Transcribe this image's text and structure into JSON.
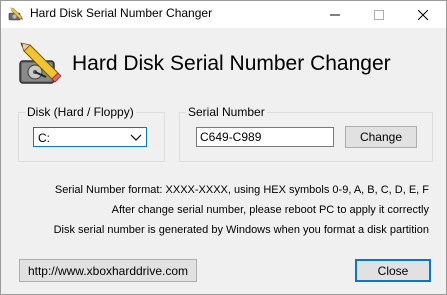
{
  "window": {
    "title": "Hard Disk Serial Number Changer"
  },
  "header": {
    "heading": "Hard Disk Serial Number Changer"
  },
  "disk_group": {
    "label": "Disk (Hard / Floppy)",
    "selected_value": "C:"
  },
  "serial_group": {
    "label": "Serial Number",
    "value": "C649-C989",
    "change_button": "Change"
  },
  "info": {
    "line1": "Serial Number format: XXXX-XXXX, using HEX symbols 0-9, A, B, C, D, E, F",
    "line2": "After change serial number, please reboot PC to apply it correctly",
    "line3": "Disk serial number is generated by Windows when you format a disk partition"
  },
  "footer": {
    "link_button": "http://www.xboxharddrive.com",
    "close_button": "Close"
  },
  "icons": {
    "app": "hard-drive-pencil-icon",
    "minimize": "minimize-icon",
    "maximize": "maximize-icon",
    "close": "close-icon",
    "dropdown": "chevron-down-icon"
  },
  "colors": {
    "focus_accent": "#0078d7",
    "window_bg": "#f0f0f0",
    "button_bg": "#e1e1e1"
  }
}
